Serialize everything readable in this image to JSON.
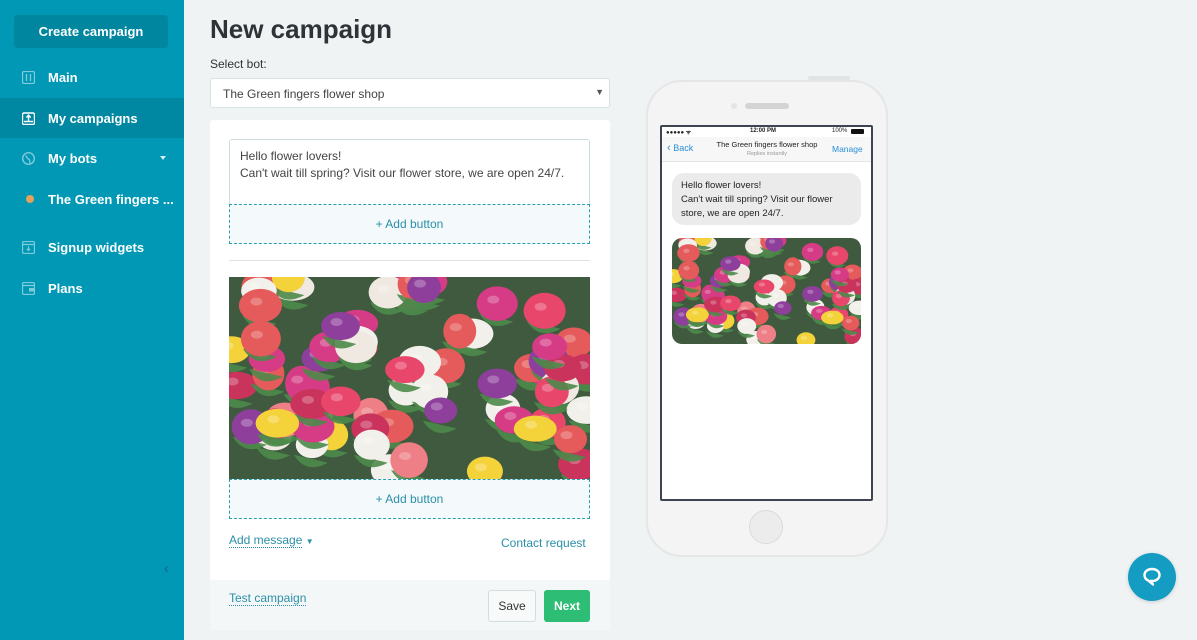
{
  "sidebar": {
    "create_button": "Create campaign",
    "items": [
      {
        "label": "Main",
        "icon": "sliders-icon"
      },
      {
        "label": "My campaigns",
        "icon": "upload-box-icon",
        "active": true
      },
      {
        "label": "My bots",
        "icon": "globe-icon",
        "expandable": true
      },
      {
        "label": "The Green fingers ...",
        "icon": "status-dot"
      },
      {
        "label": "Signup widgets",
        "icon": "widget-icon"
      },
      {
        "label": "Plans",
        "icon": "wallet-icon"
      }
    ],
    "collapse_glyph": "‹"
  },
  "main": {
    "title": "New campaign",
    "select_label": "Select bot:",
    "selected_bot": "The Green fingers flower shop",
    "select_arrow": "▼",
    "message_text": "Hello flower lovers!\nCan't wait till spring? Visit our flower store, we are open 24/7.",
    "add_button_label": "+ Add button",
    "add_message": "Add message",
    "contact_request": "Contact request",
    "test_campaign": "Test campaign",
    "save": "Save",
    "next": "Next"
  },
  "preview": {
    "signal": "●●●●● ᯤ",
    "time": "12:00 PM",
    "battery": "100%",
    "back": "Back",
    "bot_name": "The Green fingers flower shop",
    "subtitle": "Replies instantly",
    "manage": "Manage",
    "bubble_text": "Hello flower lovers!\nCan't wait till spring? Visit our flower store, we are open 24/7."
  },
  "colors": {
    "sidebar": "#0098b5",
    "accent": "#2a8fa8",
    "next_button": "#2ebd74",
    "chat_fab": "#149cc2"
  }
}
